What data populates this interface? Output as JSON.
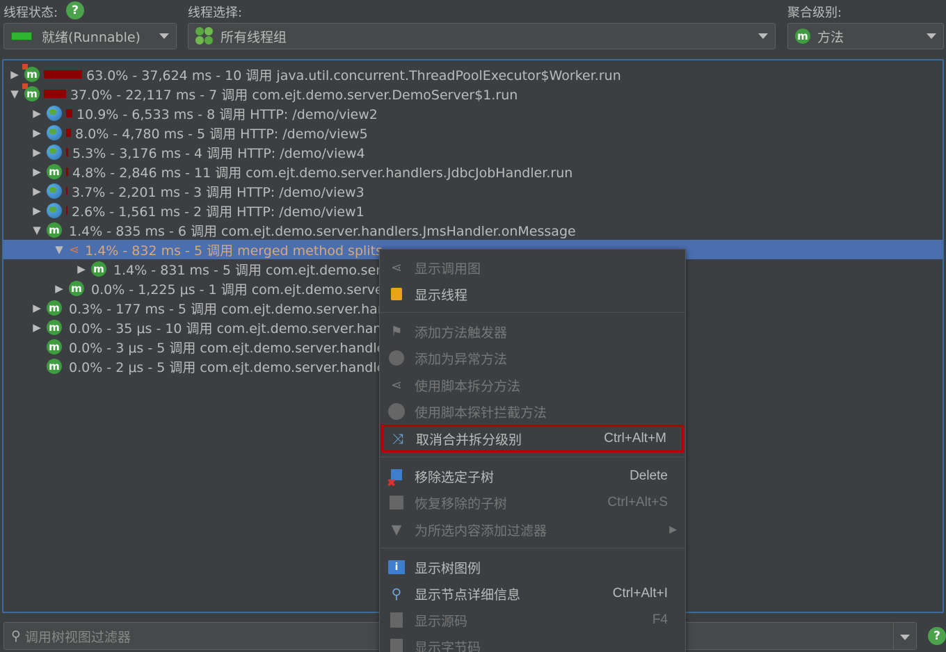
{
  "header": {
    "thread_state_label": "线程状态:",
    "thread_select_label": "线程选择:",
    "aggregation_label": "聚合级别:",
    "thread_state_value": "就绪(Runnable)",
    "thread_group_value": "所有线程组",
    "aggregation_value": "方法",
    "help_glyph": "?"
  },
  "tree": {
    "rows": [
      {
        "text": "63.0% - 37,624 ms - 10 调用 java.util.concurrent.ThreadPoolExecutor$Worker.run"
      },
      {
        "text": "37.0% - 22,117 ms - 7 调用 com.ejt.demo.server.DemoServer$1.run"
      },
      {
        "text": "10.9% - 6,533 ms - 8 调用 HTTP: /demo/view2"
      },
      {
        "text": "8.0% - 4,780 ms - 5 调用 HTTP: /demo/view5"
      },
      {
        "text": "5.3% - 3,176 ms - 4 调用 HTTP: /demo/view4"
      },
      {
        "text": "4.8% - 2,846 ms - 11 调用 com.ejt.demo.server.handlers.JdbcJobHandler.run"
      },
      {
        "text": "3.7% - 2,201 ms - 3 调用 HTTP: /demo/view3"
      },
      {
        "text": "2.6% - 1,561 ms - 2 调用 HTTP: /demo/view1"
      },
      {
        "text": "1.4% - 835 ms - 6 调用 com.ejt.demo.server.handlers.JmsHandler.onMessage"
      },
      {
        "text": "1.4% - 832 ms - 5 调用 merged method splits"
      },
      {
        "text": "1.4% - 831 ms - 5 调用 com.ejt.demo.ser"
      },
      {
        "text": "0.0% - 1,225 μs - 1 调用 com.ejt.demo.serve"
      },
      {
        "text": "0.3% - 177 ms - 5 调用 com.ejt.demo.server.har"
      },
      {
        "text": "0.0% - 35 μs - 10 调用 com.ejt.demo.server.han"
      },
      {
        "text": "0.0% - 3 μs - 5 调用 com.ejt.demo.server.handle"
      },
      {
        "text": "0.0% - 2 μs - 5 调用 com.ejt.demo.server.handle"
      }
    ]
  },
  "menu": {
    "items": [
      {
        "label": "显示调用图",
        "shortcut": ""
      },
      {
        "label": "显示线程",
        "shortcut": ""
      },
      {
        "label": "添加方法触发器",
        "shortcut": ""
      },
      {
        "label": "添加为异常方法",
        "shortcut": ""
      },
      {
        "label": "使用脚本拆分方法",
        "shortcut": ""
      },
      {
        "label": "使用脚本探针拦截方法",
        "shortcut": ""
      },
      {
        "label": "取消合并拆分级别",
        "shortcut": "Ctrl+Alt+M"
      },
      {
        "label": "移除选定子树",
        "shortcut": "Delete"
      },
      {
        "label": "恢复移除的子树",
        "shortcut": "Ctrl+Alt+S"
      },
      {
        "label": "为所选内容添加过滤器",
        "shortcut": ""
      },
      {
        "label": "显示树图例",
        "shortcut": ""
      },
      {
        "label": "显示节点详细信息",
        "shortcut": "Ctrl+Alt+I"
      },
      {
        "label": "显示源码",
        "shortcut": "F4"
      },
      {
        "label": "显示字节码",
        "shortcut": ""
      }
    ]
  },
  "filter": {
    "placeholder": "调用树视图过滤器"
  },
  "colors": {
    "background": "#3c3f41",
    "selection": "#4b6eaf",
    "bar": "#8b0000",
    "method_icon": "#3f9d3f",
    "highlight_outline": "#b30000"
  }
}
